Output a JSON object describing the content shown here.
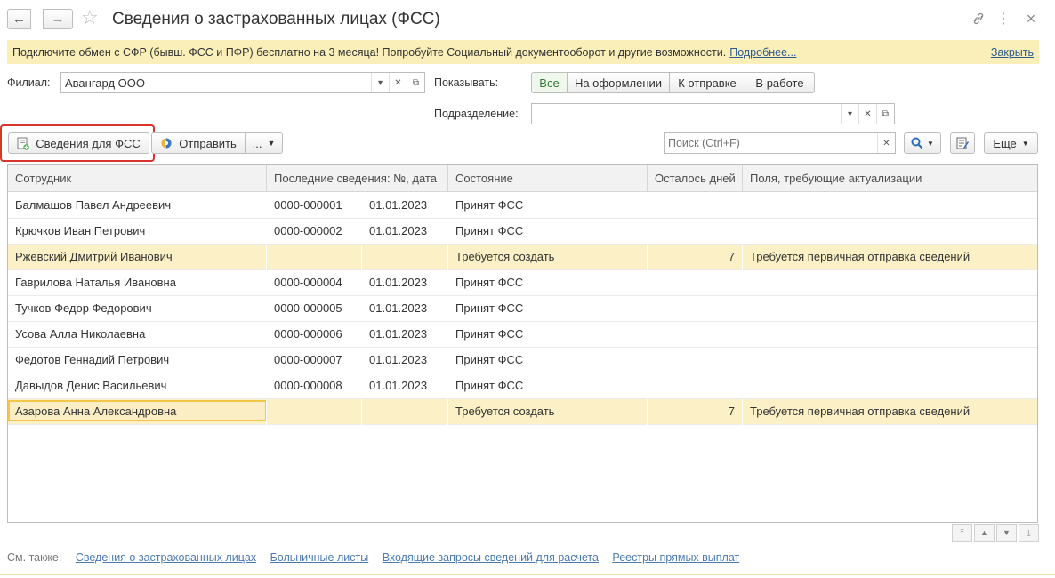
{
  "header": {
    "title": "Сведения о застрахованных лицах (ФСС)",
    "back_icon": "←",
    "forward_icon": "→",
    "star_icon": "☆",
    "link_icon": "🔗",
    "more_icon": "⋮",
    "close_icon": "×"
  },
  "banner": {
    "text": "Подключите обмен с СФР (бывш. ФСС и ПФР) бесплатно на 3 месяца! Попробуйте Социальный документооборот и другие возможности.",
    "more_link": "Подробнее...",
    "close_link": "Закрыть"
  },
  "filters": {
    "branch_label": "Филиал:",
    "branch_value": "Авангард ООО",
    "show_label": "Показывать:",
    "show_options": [
      "Все",
      "На оформлении",
      "К отправке",
      "В работе"
    ],
    "show_active": "Все",
    "department_label": "Подразделение:",
    "department_value": ""
  },
  "toolbar": {
    "fss_button": "Сведения для ФСС",
    "send_button": "Отправить",
    "dots_button": "...",
    "search_placeholder": "Поиск (Ctrl+F)",
    "more_button": "Еще"
  },
  "table": {
    "columns": [
      "Сотрудник",
      "Последние сведения: №, дата",
      "Состояние",
      "Осталось дней",
      "Поля, требующие актуализации"
    ],
    "rows": [
      {
        "employee": "Балмашов Павел Андреевич",
        "number": "0000-000001",
        "date": "01.01.2023",
        "status": "Принят ФСС",
        "days": "",
        "fields": ""
      },
      {
        "employee": "Крючков Иван Петрович",
        "number": "0000-000002",
        "date": "01.01.2023",
        "status": "Принят ФСС",
        "days": "",
        "fields": ""
      },
      {
        "employee": "Ржевский Дмитрий Иванович",
        "number": "",
        "date": "",
        "status": "Требуется создать",
        "days": "7",
        "fields": "Требуется первичная отправка сведений"
      },
      {
        "employee": "Гаврилова Наталья Ивановна",
        "number": "0000-000004",
        "date": "01.01.2023",
        "status": "Принят ФСС",
        "days": "",
        "fields": ""
      },
      {
        "employee": "Тучков Федор Федорович",
        "number": "0000-000005",
        "date": "01.01.2023",
        "status": "Принят ФСС",
        "days": "",
        "fields": ""
      },
      {
        "employee": "Усова Алла Николаевна",
        "number": "0000-000006",
        "date": "01.01.2023",
        "status": "Принят ФСС",
        "days": "",
        "fields": ""
      },
      {
        "employee": "Федотов Геннадий Петрович",
        "number": "0000-000007",
        "date": "01.01.2023",
        "status": "Принят ФСС",
        "days": "",
        "fields": ""
      },
      {
        "employee": "Давыдов Денис Васильевич",
        "number": "0000-000008",
        "date": "01.01.2023",
        "status": "Принят ФСС",
        "days": "",
        "fields": ""
      },
      {
        "employee": "Азарова Анна Александровна",
        "number": "",
        "date": "",
        "status": "Требуется создать",
        "days": "7",
        "fields": "Требуется первичная отправка сведений"
      }
    ]
  },
  "footer": {
    "see_also_label": "См. также:",
    "links": [
      "Сведения о застрахованных лицах",
      "Больничные листы",
      "Входящие запросы сведений для расчета",
      "Реестры прямых выплат"
    ]
  },
  "colors": {
    "banner_bg": "#fbefb9",
    "highlight_row": "#fbf0c6",
    "active_filter": "#2e7d32",
    "callout_frame": "#d9342b",
    "link": "#2c5a90"
  }
}
